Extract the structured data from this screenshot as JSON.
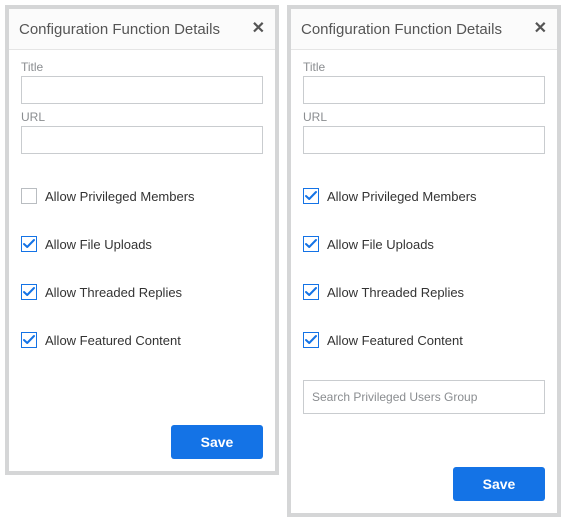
{
  "left": {
    "title": "Configuration Function Details",
    "title_label": "Title",
    "title_value": "",
    "url_label": "URL",
    "url_value": "",
    "checks": {
      "priv": {
        "label": "Allow Privileged Members",
        "checked": false
      },
      "uploads": {
        "label": "Allow File Uploads",
        "checked": true
      },
      "threads": {
        "label": "Allow Threaded Replies",
        "checked": true
      },
      "featured": {
        "label": "Allow Featured Content",
        "checked": true
      }
    },
    "save_label": "Save"
  },
  "right": {
    "title": "Configuration Function Details",
    "title_label": "Title",
    "title_value": "",
    "url_label": "URL",
    "url_value": "",
    "checks": {
      "priv": {
        "label": "Allow Privileged Members",
        "checked": true
      },
      "uploads": {
        "label": "Allow File Uploads",
        "checked": true
      },
      "threads": {
        "label": "Allow Threaded Replies",
        "checked": true
      },
      "featured": {
        "label": "Allow Featured Content",
        "checked": true
      }
    },
    "search_placeholder": "Search Privileged Users Group",
    "save_label": "Save"
  }
}
